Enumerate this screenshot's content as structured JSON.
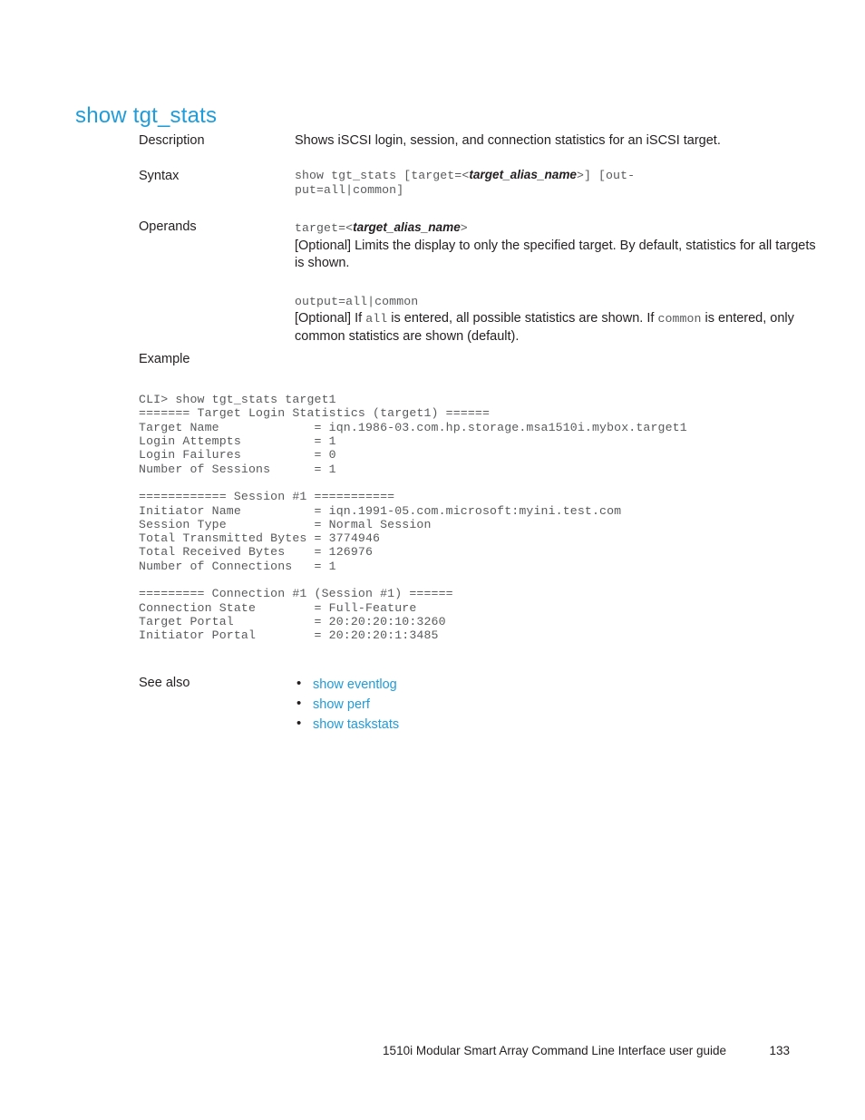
{
  "heading": "show tgt_stats",
  "labels": {
    "description": "Description",
    "syntax": "Syntax",
    "operands": "Operands",
    "example": "Example",
    "see_also": "See also"
  },
  "description": {
    "text": "Shows iSCSI login, session, and connection statistics for an iSCSI target."
  },
  "syntax": {
    "prefix": "show tgt_stats [target=<",
    "variable": "target_alias_name",
    "suffix": ">] [out-\nput=all|common]"
  },
  "operands": [
    {
      "signature_prefix": "target=<",
      "signature_variable": "target_alias_name",
      "signature_suffix": ">",
      "desc_part1": "[Optional] Limits the display to only the specified target.  By default, statistics for all targets is shown."
    },
    {
      "signature": "output=all|common",
      "desc_a": "[Optional] If ",
      "desc_code1": "all",
      "desc_b": " is entered, all possible statistics are shown.  If ",
      "desc_code2": "common",
      "desc_c": " is entered, only common statistics are shown (default)."
    }
  ],
  "example": {
    "code": "CLI> show tgt_stats target1\n======= Target Login Statistics (target1) ======\nTarget Name             = iqn.1986-03.com.hp.storage.msa1510i.mybox.target1\nLogin Attempts          = 1\nLogin Failures          = 0\nNumber of Sessions      = 1\n\n============ Session #1 ===========\nInitiator Name          = iqn.1991-05.com.microsoft:myini.test.com\nSession Type            = Normal Session\nTotal Transmitted Bytes = 3774946\nTotal Received Bytes    = 126976\nNumber of Connections   = 1\n\n========= Connection #1 (Session #1) ======\nConnection State        = Full-Feature\nTarget Portal           = 20:20:20:10:3260\nInitiator Portal        = 20:20:20:1:3485"
  },
  "see_also": [
    {
      "label": "show eventlog"
    },
    {
      "label": "show perf"
    },
    {
      "label": "show taskstats"
    }
  ],
  "footer": {
    "guide_title": "1510i Modular Smart Array Command Line Interface user guide",
    "page_number": "133"
  },
  "colors": {
    "heading": "#1f9cd9",
    "link": "#1f9cd9",
    "body_text": "#231f20",
    "code_text": "#58595b"
  }
}
